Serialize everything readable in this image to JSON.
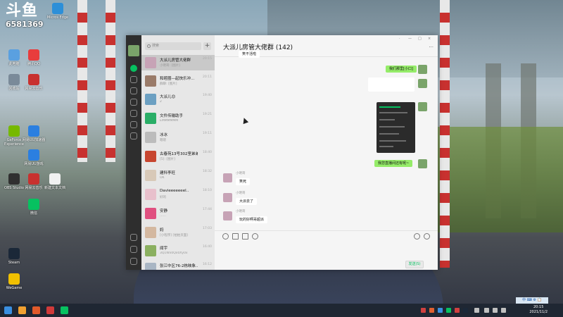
{
  "overlay": {
    "logo_text": "斗鱼",
    "room_number": "6581369"
  },
  "desktop_icons": [
    {
      "label": "Micros Edge",
      "color": "#2d8fd8"
    },
    {
      "label": "腾讯QQ",
      "color": "#e83d3d"
    },
    {
      "label": "此电脑",
      "color": "#5aa0e0"
    },
    {
      "label": "网易云音乐",
      "color": "#c8312f"
    },
    {
      "label": "回收站",
      "color": "#7a8a99"
    },
    {
      "label": "GeForce Experience",
      "color": "#76b900"
    },
    {
      "label": "网易UU加速器",
      "color": "#2b7fe0"
    },
    {
      "label": "网易UU游戏",
      "color": "#2b7fe0"
    },
    {
      "label": "OBS Studio",
      "color": "#303030"
    },
    {
      "label": "网易云音乐",
      "color": "#c8312f"
    },
    {
      "label": "新建文本文档",
      "color": "#f1f1f1"
    },
    {
      "label": "微信",
      "color": "#07c160"
    },
    {
      "label": "Steam",
      "color": "#1b2838"
    },
    {
      "label": "WeGame",
      "color": "#f0c000"
    }
  ],
  "wechat": {
    "title": "大派儿房管大佬群 (142)",
    "search_placeholder": "搜索",
    "plus": "+",
    "window_controls": [
      "·",
      "—",
      "□",
      "×"
    ],
    "more": "···",
    "chats": [
      {
        "name": "大派儿房管大佬群",
        "preview": "小明哥: [图片]",
        "time": "20:15",
        "color": "#c7a3b6",
        "selected": true
      },
      {
        "name": "和睦圈—起快乐冲...",
        "preview": "群聊: [图片]",
        "time": "20:11",
        "color": "#9a7b69",
        "selected": false
      },
      {
        "name": "大派儿😊",
        "preview": "2",
        "time": "19:40",
        "color": "#6ca0c2",
        "selected": false
      },
      {
        "name": "文件传输助手",
        "preview": "EMMMMMM",
        "time": "19:21",
        "color": "#2aae67",
        "selected": false
      },
      {
        "name": "冰冰",
        "preview": "嗯嗯",
        "time": "19:11",
        "color": "#bcbcbc",
        "selected": false
      },
      {
        "name": "古春苑13号302室弟弟",
        "preview": "[5]: [图片]",
        "time": "18:40",
        "color": "#c7452f",
        "selected": false
      },
      {
        "name": "建科李旺",
        "preview": "OK",
        "time": "18:32",
        "color": "#d8c9b8",
        "selected": false
      },
      {
        "name": "Davieeeeeeel..",
        "preview": "好的",
        "time": "18:10",
        "color": "#e8c0cc",
        "selected": false
      },
      {
        "name": "安静",
        "preview": "……",
        "time": "17:44",
        "color": "#e05080",
        "selected": false
      },
      {
        "name": "妈",
        "preview": "[小程序] [拍拍页面]",
        "time": "17:03",
        "color": "#d4b8a0",
        "selected": false
      },
      {
        "name": "闻宇",
        "preview": "3Q1Wx0Qx0Xy0x",
        "time": "16:40",
        "color": "#8bb060",
        "selected": false
      },
      {
        "name": "张江中区76-2栋映象...",
        "preview": "",
        "time": "16:12",
        "color": "#a9b6c4",
        "selected": false
      }
    ],
    "messages": {
      "top_partial": "笑不活啦",
      "mine_1": "我们那里[小口]",
      "mine_2": "我您直播间还有呢~",
      "sender": "小明哥",
      "other_1": "笑死",
      "other_2": "大派去了",
      "other_3": "玩的好啊哥超派"
    },
    "send_button": "发送(S)"
  },
  "taskbar": {
    "time": "20:15",
    "date": "2021/11/2"
  },
  "ime": {
    "label": "中 ⌨ ⚙ 📋"
  }
}
